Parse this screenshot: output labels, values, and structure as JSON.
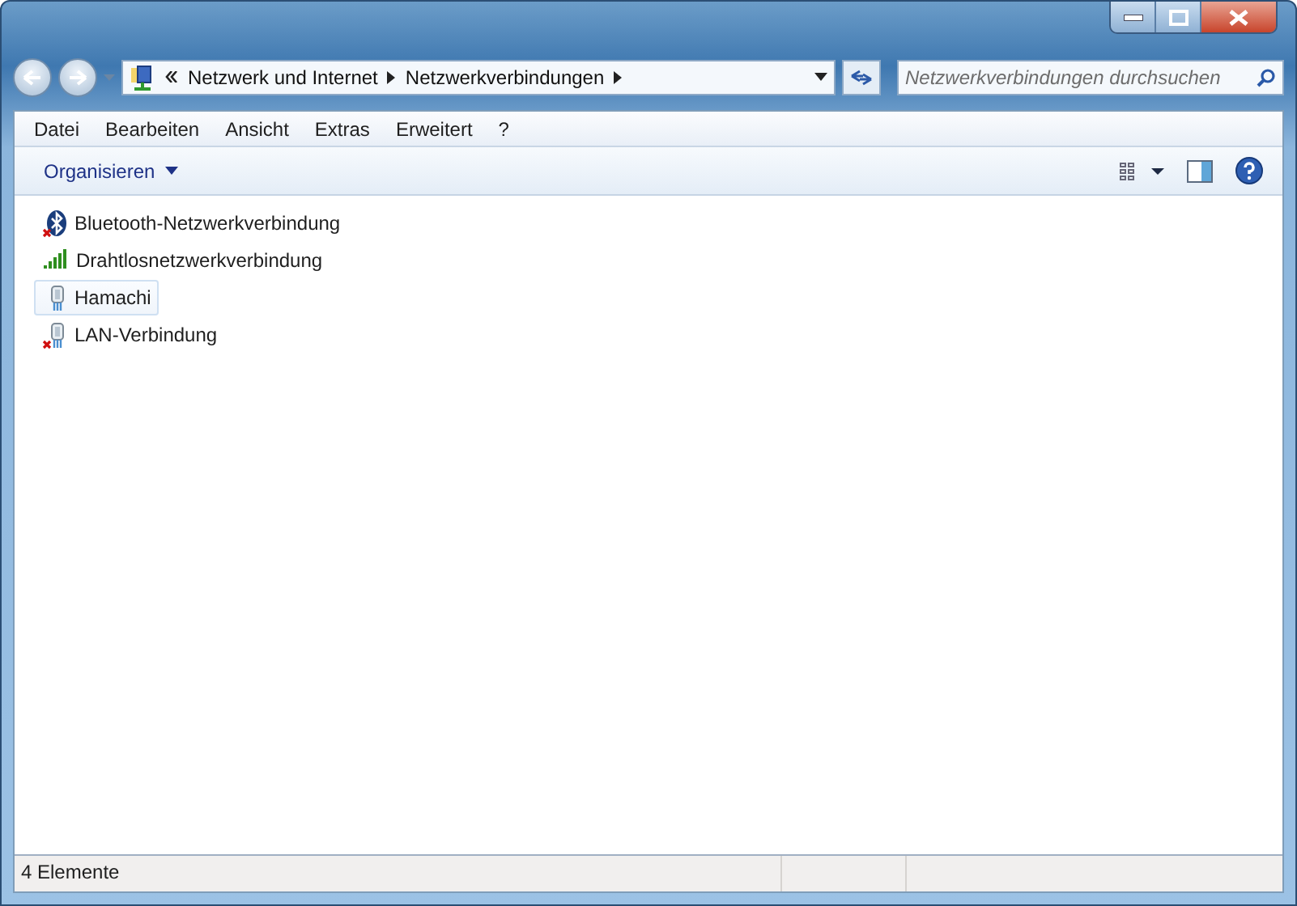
{
  "address_bar": {
    "crumbs": [
      "Netzwerk und Internet",
      "Netzwerkverbindungen"
    ]
  },
  "search": {
    "placeholder": "Netzwerkverbindungen durchsuchen"
  },
  "menu": [
    "Datei",
    "Bearbeiten",
    "Ansicht",
    "Extras",
    "Erweitert",
    "?"
  ],
  "toolbar": {
    "organize": "Organisieren"
  },
  "items": [
    {
      "name": "Bluetooth-Netzwerkverbindung",
      "kind": "bluetooth",
      "disconnected": true,
      "selected": false
    },
    {
      "name": "Drahtlosnetzwerkverbindung",
      "kind": "wireless",
      "disconnected": false,
      "selected": false
    },
    {
      "name": "Hamachi",
      "kind": "cable",
      "disconnected": false,
      "selected": true
    },
    {
      "name": "LAN-Verbindung",
      "kind": "cable",
      "disconnected": true,
      "selected": false
    }
  ],
  "status_bar": {
    "count": "4 Elemente"
  }
}
